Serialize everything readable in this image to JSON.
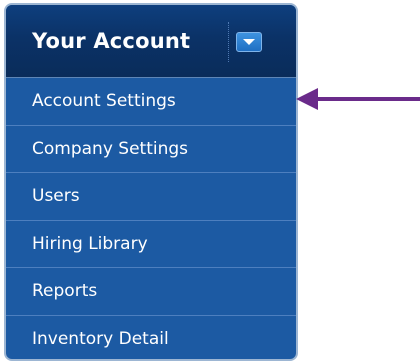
{
  "menu": {
    "title": "Your Account",
    "dropdown_icon": "chevron-down-icon",
    "items": [
      {
        "label": "Account Settings"
      },
      {
        "label": "Company Settings"
      },
      {
        "label": "Users"
      },
      {
        "label": "Hiring Library"
      },
      {
        "label": "Reports"
      },
      {
        "label": "Inventory Detail"
      }
    ]
  },
  "annotation": {
    "arrow_target": "Account Settings",
    "arrow_color": "#6a2b8a"
  },
  "colors": {
    "menu_bg": "#1c5aa3",
    "header_bg": "#0b3267",
    "text": "#ffffff"
  }
}
